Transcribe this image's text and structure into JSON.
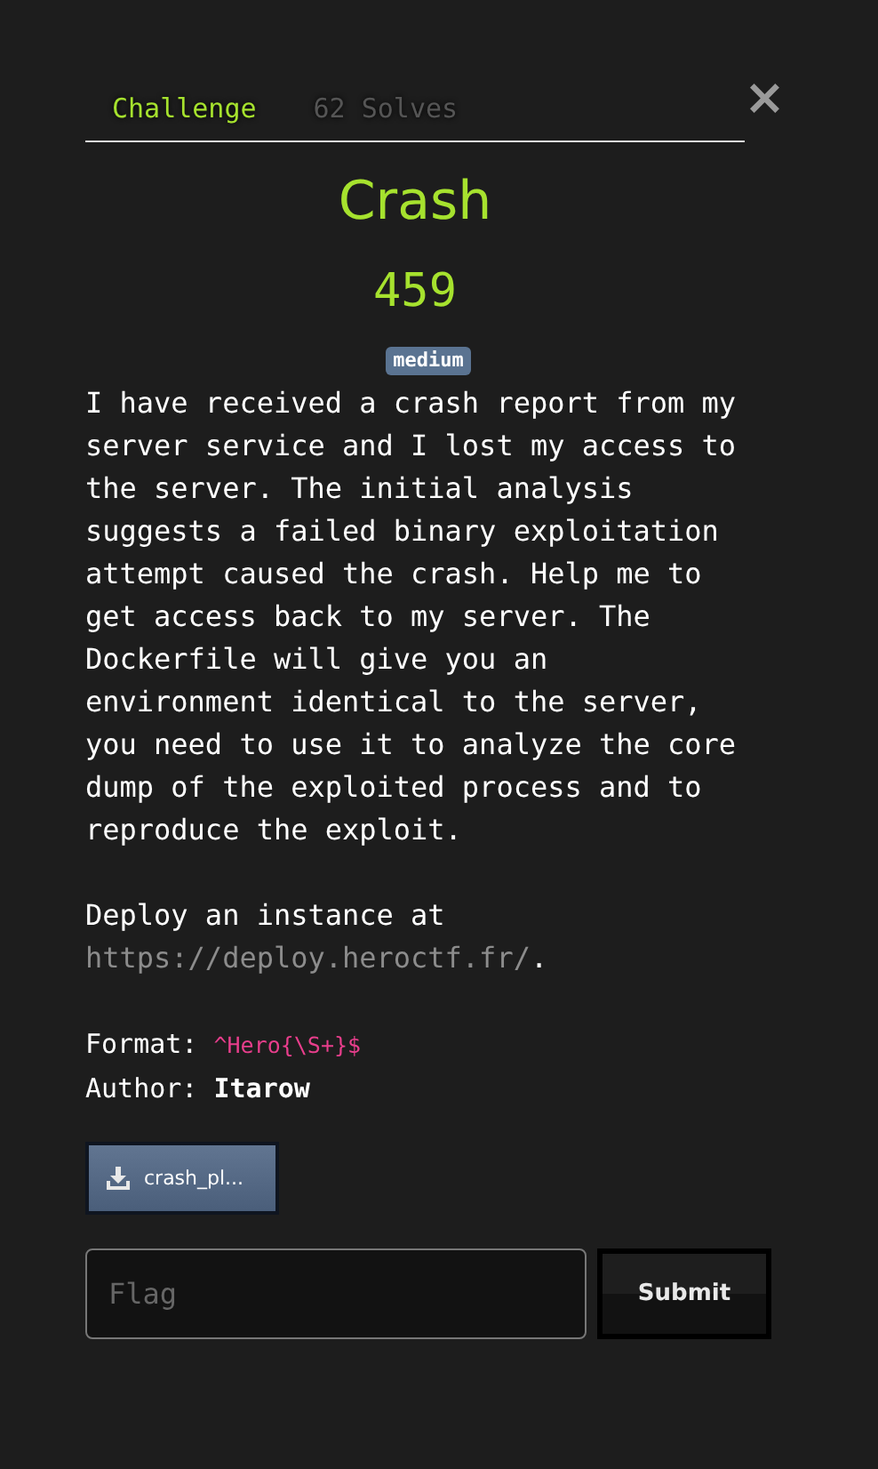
{
  "tabs": [
    {
      "label": "Challenge",
      "selected": true
    },
    {
      "label": "62 Solves",
      "selected": false
    }
  ],
  "close": "×",
  "challenge": {
    "name": "Crash",
    "points": "459",
    "difficulty": "medium"
  },
  "description": "I have received a crash report from my server service and I lost my access to the server. The initial analysis suggests a failed binary exploitation attempt caused the crash. Help me to get access back to my server. The Dockerfile will give you an environment identical to the server, you need to use it to analyze the core dump of the exploited process and to reproduce the exploit.",
  "deploy": {
    "text": "Deploy an instance at",
    "link": "https://deploy.heroctf.fr/",
    "after": "."
  },
  "format": {
    "label": "Format:",
    "value": "^Hero{\\S+}$"
  },
  "author": {
    "label": "Author:",
    "value": "Itarow"
  },
  "files": [
    "crash_pl..."
  ],
  "flag_field": {
    "placeholder": "Flag"
  },
  "submit": "Submit"
}
